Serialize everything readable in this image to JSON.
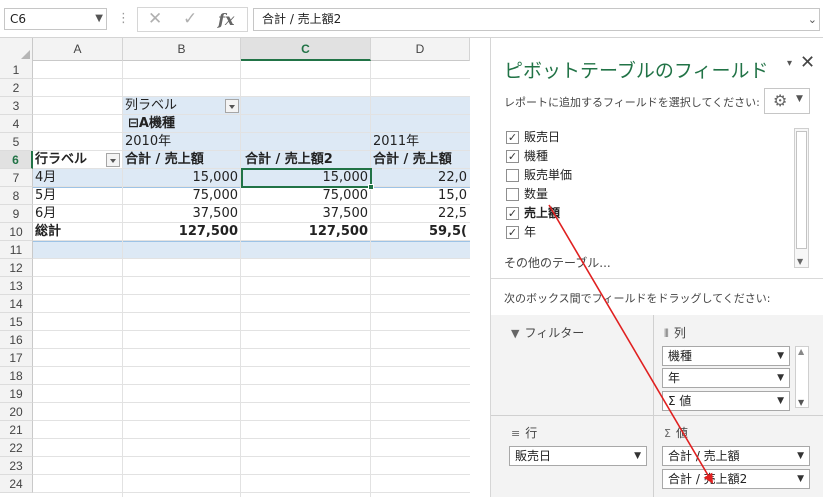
{
  "formula_bar": {
    "name_box": "C6",
    "separator": "⋮",
    "cancel_glyph": "✕",
    "enter_glyph": "✓",
    "fx_glyph": "fx",
    "formula": "合計 / 売上額2"
  },
  "grid": {
    "columns": [
      "A",
      "B",
      "C",
      "D"
    ],
    "active_column": "C",
    "rows": [
      "1",
      "2",
      "3",
      "4",
      "5",
      "6",
      "7",
      "8",
      "9",
      "10",
      "11",
      "12",
      "13",
      "14",
      "15",
      "16",
      "17",
      "18",
      "19",
      "20",
      "21",
      "22",
      "23",
      "24"
    ],
    "active_row": "6",
    "pivot": {
      "col_label_header": "列ラベル",
      "group": "⊟A機種",
      "year_2010": "2010年",
      "year_2011": "2011年",
      "row_label_header": "行ラベル",
      "b6": "合計 / 売上額",
      "c6": "合計 / 売上額2",
      "d6": "合計 / 売上額",
      "data_rows": [
        {
          "label": "4月",
          "b": "15,000",
          "c": "15,000",
          "d": "22,0"
        },
        {
          "label": "5月",
          "b": "75,000",
          "c": "75,000",
          "d": "15,0"
        },
        {
          "label": "6月",
          "b": "37,500",
          "c": "37,500",
          "d": "22,5"
        }
      ],
      "total": {
        "label": "総計",
        "b": "127,500",
        "c": "127,500",
        "d": "59,5("
      }
    }
  },
  "panel": {
    "title": "ピボットテーブルのフィールド",
    "pin": "▾",
    "close": "✕",
    "choose_prompt": "レポートに追加するフィールドを選択してください:",
    "fields": [
      {
        "label": "販売日",
        "checked": "✓"
      },
      {
        "label": "機種",
        "checked": "✓"
      },
      {
        "label": "販売単価",
        "checked": ""
      },
      {
        "label": "数量",
        "checked": ""
      },
      {
        "label": "売上額",
        "checked": "✓"
      },
      {
        "label": "年",
        "checked": "✓"
      }
    ],
    "more_tables": "その他のテーブル...",
    "drag_prompt": "次のボックス間でフィールドをドラッグしてください:",
    "areas": {
      "filter_title": "フィルター",
      "columns_title": "列",
      "rows_title": "行",
      "values_title": "値",
      "column_items": [
        "機種",
        "年",
        "Σ 値"
      ],
      "row_items": [
        "販売日"
      ],
      "value_items": [
        "合計 / 売上額",
        "合計 / 売上額2"
      ]
    },
    "icons": {
      "gear": "gear-icon",
      "filter": "filter-icon",
      "columns": "columns-icon",
      "rows": "rows-icon",
      "values": "sigma-icon"
    }
  },
  "annotation": {
    "arrow_color": "#e02020",
    "from": "売上額",
    "to": "合計 / 売上額2"
  },
  "colors": {
    "accent": "#217346",
    "pivot_band": "#dde9f5"
  }
}
